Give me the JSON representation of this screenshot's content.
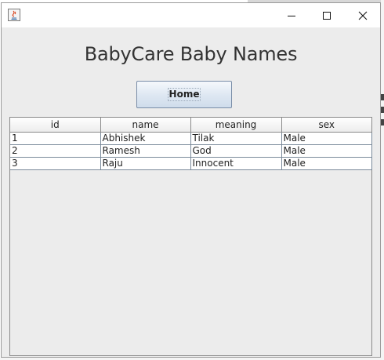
{
  "window": {
    "title": "",
    "icon": "java-icon",
    "controls": {
      "minimize_icon": "minimize-icon",
      "maximize_icon": "maximize-icon",
      "close_icon": "close-icon"
    }
  },
  "header": {
    "title": "BabyCare Baby Names"
  },
  "actions": {
    "home_label": "Home"
  },
  "table": {
    "columns": [
      "id",
      "name",
      "meaning",
      "sex"
    ],
    "rows": [
      [
        "1",
        "Abhishek",
        "Tilak",
        "Male"
      ],
      [
        "2",
        "Ramesh",
        "God",
        "Male"
      ],
      [
        "3",
        "Raju",
        "Innocent",
        "Male"
      ]
    ]
  },
  "colors": {
    "window_bg": "#ececec",
    "titlebar_bg": "#ffffff",
    "button_border": "#7a8ea8"
  }
}
